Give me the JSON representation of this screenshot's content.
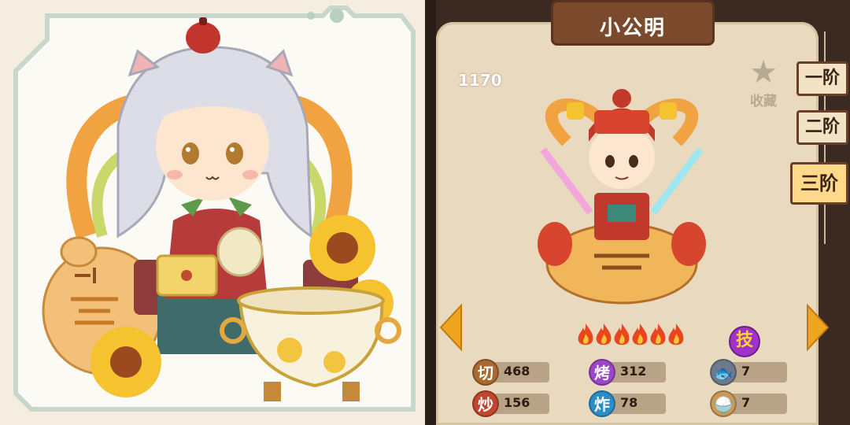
{
  "character": {
    "name": "小公明",
    "score": "1170"
  },
  "favorite": {
    "icon": "star-icon",
    "label": "收藏"
  },
  "tiers": [
    {
      "label": "一阶"
    },
    {
      "label": "二阶"
    },
    {
      "label": "三阶"
    }
  ],
  "selected_tier": "三阶",
  "rating": {
    "flames": 6,
    "max": 6
  },
  "skill": {
    "label": "技"
  },
  "stats": [
    {
      "icon": "切",
      "value": "468",
      "color": "#a9692f"
    },
    {
      "icon": "烤",
      "value": "312",
      "color": "#9b45c9"
    },
    {
      "icon": "fish-icon",
      "value": "7",
      "color": "#6d7a8c"
    },
    {
      "icon": "炒",
      "value": "156",
      "color": "#c2452d"
    },
    {
      "icon": "炸",
      "value": "78",
      "color": "#2c8ec9"
    },
    {
      "icon": "rice-bowl-icon",
      "value": "7",
      "color": "#c99b5a"
    }
  ],
  "colors": {
    "board": "#e9d9be",
    "plank": "#7b4a2c",
    "tier_active": "#ffd88a",
    "arrow": "#f0a51e",
    "flame": "#e8461e"
  }
}
